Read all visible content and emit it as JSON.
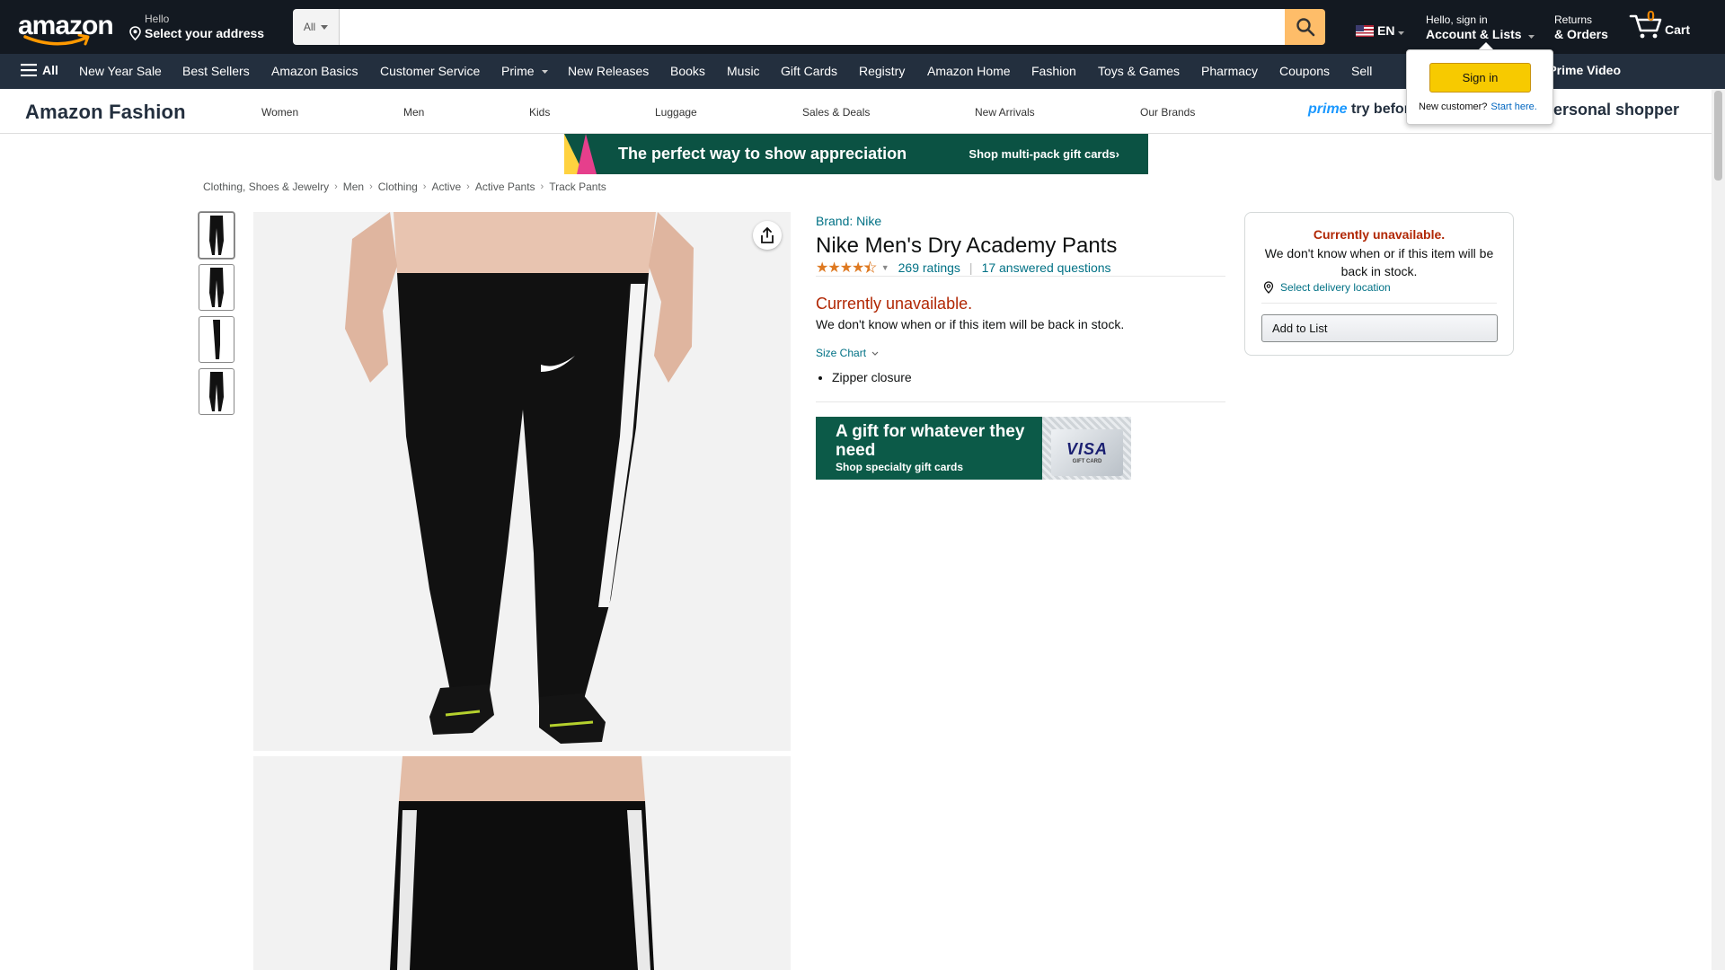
{
  "header": {
    "logo": "amazon",
    "deliver_line1": "Hello",
    "deliver_line2": "Select your address",
    "search_category": "All",
    "search_placeholder": "",
    "language": "EN",
    "account_line1": "Hello, sign in",
    "account_line2": "Account & Lists",
    "returns_line1": "Returns",
    "returns_line2": "& Orders",
    "cart_count": "0",
    "cart_label": "Cart"
  },
  "nav": {
    "all_label": "All",
    "items": [
      "New Year Sale",
      "Best Sellers",
      "Amazon Basics",
      "Customer Service",
      "Prime",
      "New Releases",
      "Books",
      "Music",
      "Gift Cards",
      "Registry",
      "Amazon Home",
      "Fashion",
      "Toys & Games",
      "Pharmacy",
      "Coupons",
      "Sell"
    ],
    "promo": "ootball on Prime Video"
  },
  "signin_flyout": {
    "button": "Sign in",
    "new_customer": "New customer?",
    "start_here": "Start here."
  },
  "fashion_nav": {
    "title": "Amazon Fashion",
    "items": [
      "Women",
      "Men",
      "Kids",
      "Luggage",
      "Sales & Deals",
      "New Arrivals",
      "Our Brands"
    ],
    "prime_try_prime": "prime",
    "prime_try_rest": " try before",
    "personal_shopper": "personal shopper"
  },
  "banner": {
    "message": "The perfect way to show appreciation",
    "cta": "Shop multi-pack gift cards›"
  },
  "breadcrumb": [
    "Clothing, Shoes & Jewelry",
    "Men",
    "Clothing",
    "Active",
    "Active Pants",
    "Track Pants"
  ],
  "product": {
    "brand": "Brand: Nike",
    "title": "Nike Men's Dry Academy Pants",
    "rating_stars": 4.5,
    "ratings_count": "269 ratings",
    "answered_questions": "17 answered questions",
    "availability": "Currently unavailable.",
    "availability_note": "We don't know when or if this item will be back in stock.",
    "size_chart": "Size Chart",
    "bullets": [
      "Zipper closure"
    ]
  },
  "gift_ad": {
    "headline": "A gift for whatever they need",
    "subline": "Shop specialty gift cards",
    "card_brand": "VISA",
    "card_text": "GIFT CARD"
  },
  "buybox": {
    "availability": "Currently unavailable.",
    "note": "We don't know when or if this item will be back in stock.",
    "delivery": "Select delivery location",
    "add_to_list": "Add to List"
  },
  "colors": {
    "header_bg": "#131921",
    "nav_bg": "#232f3e",
    "search_button": "#febd69",
    "link": "#007185",
    "unavailable": "#b12704",
    "star": "#de7921"
  }
}
